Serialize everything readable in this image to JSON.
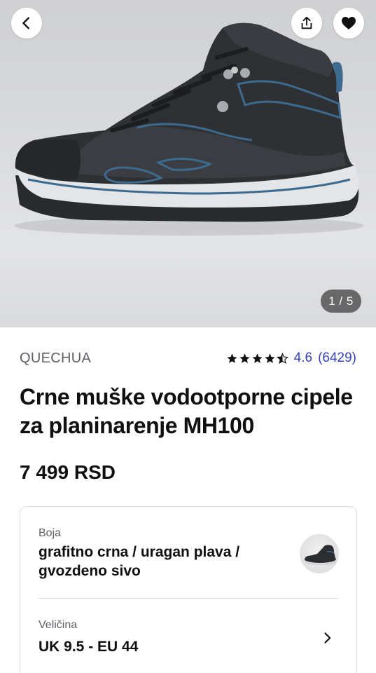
{
  "gallery": {
    "counter": "1 / 5",
    "image_alt": "shoe-product-image"
  },
  "icons": {
    "back": "chevron-left-icon",
    "share": "share-icon",
    "favorite": "heart-icon",
    "size_chevron": "chevron-right-icon"
  },
  "product": {
    "brand": "QUECHUA",
    "rating_value": "4.6",
    "rating_count": "(6429)",
    "rating_stars": 4.5,
    "title": "Crne muške vodootporne cipele za planinarenje MH100",
    "price": "7 499 RSD"
  },
  "options": {
    "color_label": "Boja",
    "color_value": "grafitno crna / uragan plava / gvozdeno sivo",
    "size_label": "Veličina",
    "size_value": "UK 9.5 - EU 44"
  },
  "colors": {
    "accent": "#3643ba",
    "text": "#101010",
    "muted": "#5d5f63",
    "shoe_body": "#2b2d31",
    "shoe_accent": "#3d6a8f"
  }
}
